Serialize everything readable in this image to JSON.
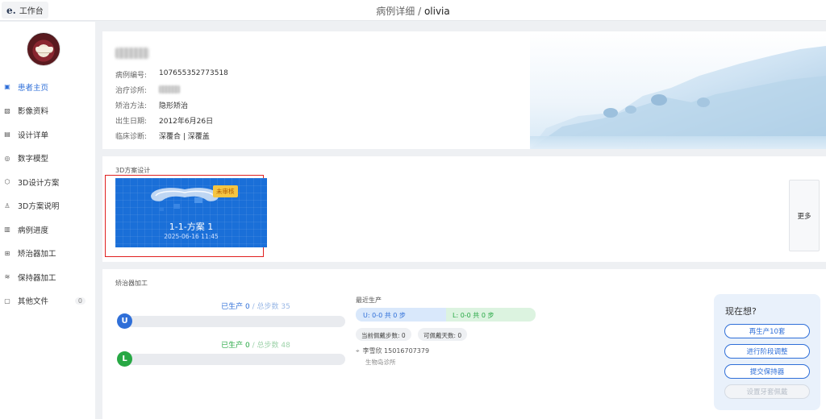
{
  "topbar": {
    "logo": "e.",
    "workspace_label": "工作台",
    "title_prefix": "病例详细 /",
    "title_user": "olivia"
  },
  "sidebar": {
    "items": [
      {
        "icon": "patient-home-icon",
        "glyph": "▣",
        "label": "患者主页",
        "active": true
      },
      {
        "icon": "image-data-icon",
        "glyph": "▧",
        "label": "影像资料"
      },
      {
        "icon": "design-detail-icon",
        "glyph": "▤",
        "label": "设计详单"
      },
      {
        "icon": "digital-model-icon",
        "glyph": "◎",
        "label": "数字模型"
      },
      {
        "icon": "cube-3d-icon",
        "glyph": "⬡",
        "label": "3D设计方案"
      },
      {
        "icon": "explain-3d-icon",
        "glyph": "♙",
        "label": "3D方案说明"
      },
      {
        "icon": "progress-icon",
        "glyph": "▥",
        "label": "病例进度"
      },
      {
        "icon": "aligner-production-icon",
        "glyph": "⊞",
        "label": "矫治器加工"
      },
      {
        "icon": "retainer-production-icon",
        "glyph": "≋",
        "label": "保持器加工"
      },
      {
        "icon": "file-icon",
        "glyph": "▢",
        "label": "其他文件",
        "count": "0"
      }
    ]
  },
  "patient": {
    "rows": [
      {
        "key": "病例编号:",
        "value": "107655352773518"
      },
      {
        "key": "治疗诊所:",
        "value": ""
      },
      {
        "key": "矫治方法:",
        "value": "隐形矫治"
      },
      {
        "key": "出生日期:",
        "value": "2012年6月26日"
      },
      {
        "key": "临床诊断:",
        "value": "深覆合 | 深覆盖"
      }
    ]
  },
  "design": {
    "section_title": "3D方案设计",
    "plan_name": "1-1-方案 1",
    "plan_date": "2025-06-16 11:45",
    "status_badge": "未审核",
    "more_label": "更多",
    "card_color": "#1a6fd8",
    "highlight_color": "#e02020"
  },
  "production": {
    "section_title": "矫治器加工",
    "upper": {
      "letter": "U",
      "produced_label": "已生产",
      "produced": "0",
      "separator": "/",
      "total_label": "总步数",
      "total": "35",
      "progress": 0
    },
    "lower": {
      "letter": "L",
      "produced_label": "已生产",
      "produced": "0",
      "separator": "/",
      "total_label": "总步数",
      "total": "48",
      "progress": 0
    },
    "recent_title": "最近生产",
    "upper_pill": "U:  0-0 共 0 步",
    "lower_pill": "L:  0-0 共 0 步",
    "current_steps": "当前佩戴步数: 0",
    "wear_days": "可佩戴天数: 0",
    "contact_name": "李雪欣 15016707379",
    "contact_clinic": "生物岛诊所"
  },
  "actions": {
    "title": "现在想?",
    "buttons": [
      {
        "label": "再生产10套",
        "enabled": true
      },
      {
        "label": "进行阶段调整",
        "enabled": true
      },
      {
        "label": "提交保持器",
        "enabled": true
      },
      {
        "label": "设置牙套佩戴",
        "enabled": false
      }
    ]
  },
  "colors": {
    "accent": "#2f6fd8",
    "green": "#27a844"
  }
}
